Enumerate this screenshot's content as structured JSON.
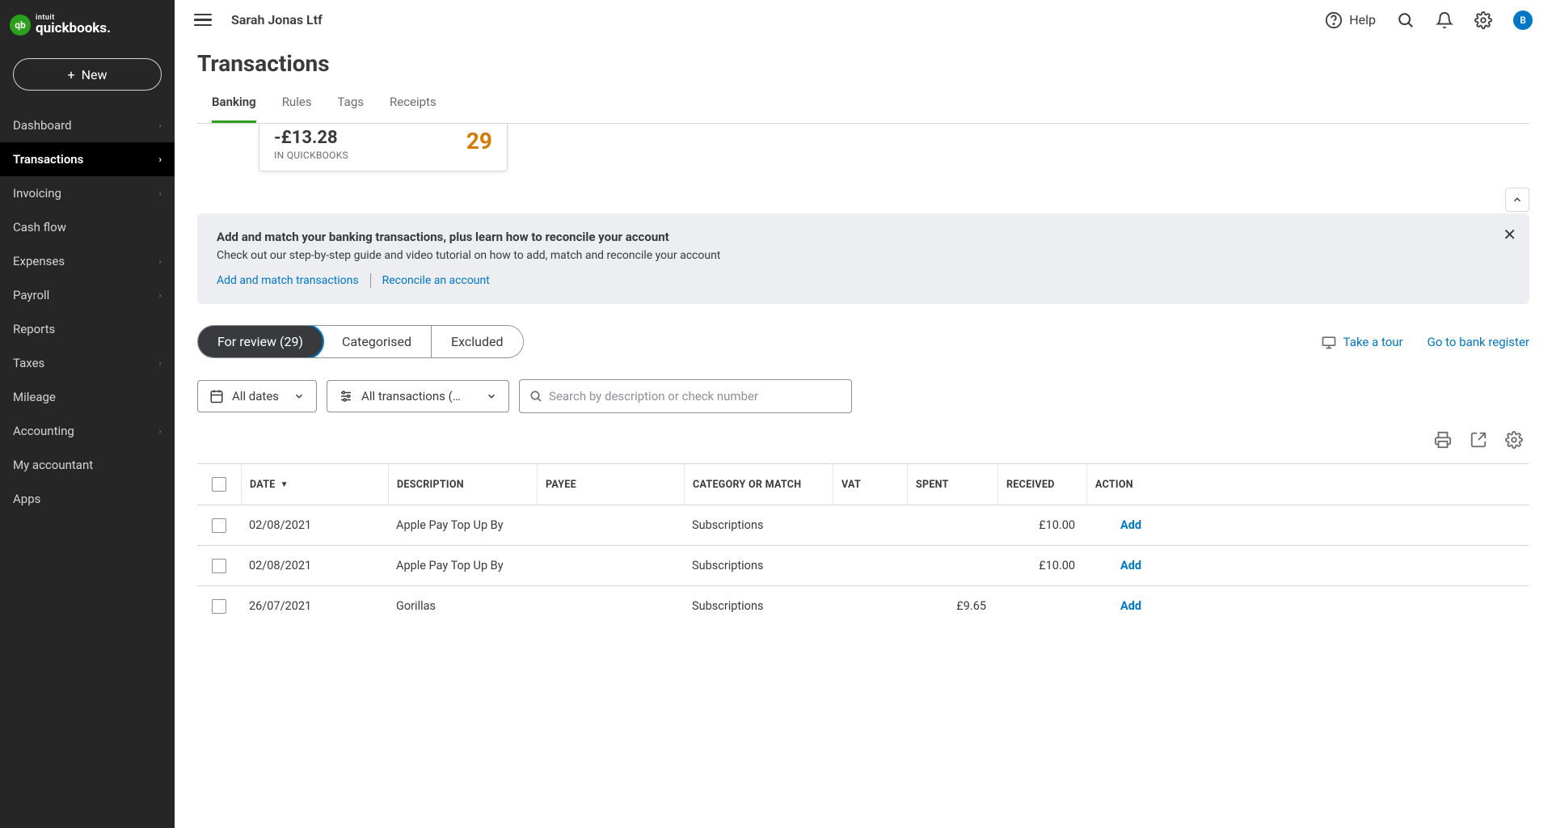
{
  "brand": {
    "supertitle": "intuit",
    "title": "quickbooks.",
    "mark": "qb"
  },
  "company_name": "Sarah Jonas Ltf",
  "new_button_label": "New",
  "help_label": "Help",
  "avatar_initial": "B",
  "sidebar": {
    "items": [
      {
        "label": "Dashboard",
        "has_chevron": true
      },
      {
        "label": "Transactions",
        "has_chevron": true,
        "active": true
      },
      {
        "label": "Invoicing",
        "has_chevron": true
      },
      {
        "label": "Cash flow",
        "has_chevron": false
      },
      {
        "label": "Expenses",
        "has_chevron": true
      },
      {
        "label": "Payroll",
        "has_chevron": true
      },
      {
        "label": "Reports",
        "has_chevron": false
      },
      {
        "label": "Taxes",
        "has_chevron": true
      },
      {
        "label": "Mileage",
        "has_chevron": false
      },
      {
        "label": "Accounting",
        "has_chevron": true
      },
      {
        "label": "My accountant",
        "has_chevron": false
      },
      {
        "label": "Apps",
        "has_chevron": false
      }
    ]
  },
  "page_title": "Transactions",
  "subtabs": [
    {
      "label": "Banking",
      "active": true
    },
    {
      "label": "Rules"
    },
    {
      "label": "Tags"
    },
    {
      "label": "Receipts"
    }
  ],
  "bank_card": {
    "balance": "-£13.28",
    "sublabel": "IN QUICKBOOKS",
    "count": "29"
  },
  "banner": {
    "title": "Add and match your banking transactions, plus learn how to reconcile your account",
    "text": "Check out our step-by-step guide and video tutorial on how to add, match and reconcile your account",
    "link1": "Add and match transactions",
    "link2": "Reconcile an account"
  },
  "segments": {
    "for_review": "For review (29)",
    "categorised": "Categorised",
    "excluded": "Excluded"
  },
  "take_tour": "Take a tour",
  "go_register": "Go to bank register",
  "filters": {
    "dates": "All dates",
    "transactions": "All transactions (…"
  },
  "search_placeholder": "Search by description or check number",
  "table": {
    "headers": {
      "date": "DATE",
      "description": "DESCRIPTION",
      "payee": "PAYEE",
      "category": "CATEGORY OR MATCH",
      "vat": "VAT",
      "spent": "SPENT",
      "received": "RECEIVED",
      "action": "ACTION"
    },
    "action_label": "Add",
    "rows": [
      {
        "date": "02/08/2021",
        "description": "Apple Pay Top Up By",
        "payee": "",
        "category": "Subscriptions",
        "vat": "",
        "spent": "",
        "received": "£10.00"
      },
      {
        "date": "02/08/2021",
        "description": "Apple Pay Top Up By",
        "payee": "",
        "category": "Subscriptions",
        "vat": "",
        "spent": "",
        "received": "£10.00"
      },
      {
        "date": "26/07/2021",
        "description": "Gorillas",
        "payee": "",
        "category": "Subscriptions",
        "vat": "",
        "spent": "£9.65",
        "received": ""
      }
    ]
  }
}
